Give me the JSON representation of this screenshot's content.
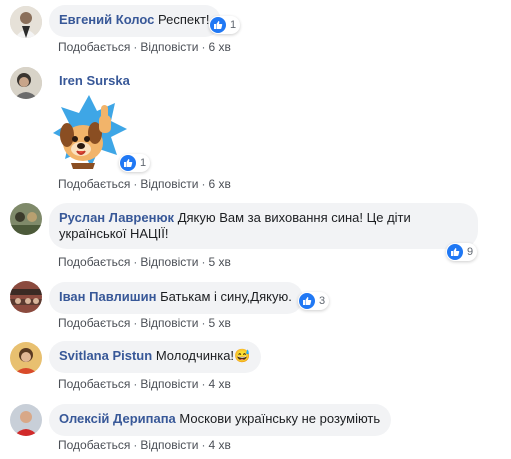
{
  "colors": {
    "author": "#385898",
    "bubble": "#f2f3f5",
    "like_blue": "#2078f4",
    "meta": "#606770"
  },
  "actions": {
    "like": "Подобається",
    "reply": "Відповісти",
    "separator": "·"
  },
  "comments": [
    {
      "author": "Евгений Колос",
      "text": "Респект!",
      "reactions": "1",
      "time": "6 хв",
      "reaction_icon": "like-icon"
    },
    {
      "author": "Iren Surska",
      "text": "",
      "sticker": "thumbs-up-dog-sticker",
      "reactions": "1",
      "time": "6 хв",
      "reaction_icon": "like-icon"
    },
    {
      "author": "Руслан Лавренюк",
      "text_line1": "Дякую Вам за виховання сина! Це діти",
      "text_line2": "української НАЦІЇ!",
      "reactions": "9",
      "time": "5 хв",
      "reaction_icon": "like-icon"
    },
    {
      "author": "Іван Павлишин",
      "text": "Батькам і сину,Дякую.",
      "reactions": "3",
      "time": "5 хв",
      "reaction_icon": "like-icon"
    },
    {
      "author": "Svitlana Pistun",
      "text": "Молодчинка!",
      "emoji": "😅",
      "time": "4 хв"
    },
    {
      "author": "Олексій Дерипапа",
      "text": "Москови українську не розуміють",
      "time": "4 хв"
    }
  ]
}
